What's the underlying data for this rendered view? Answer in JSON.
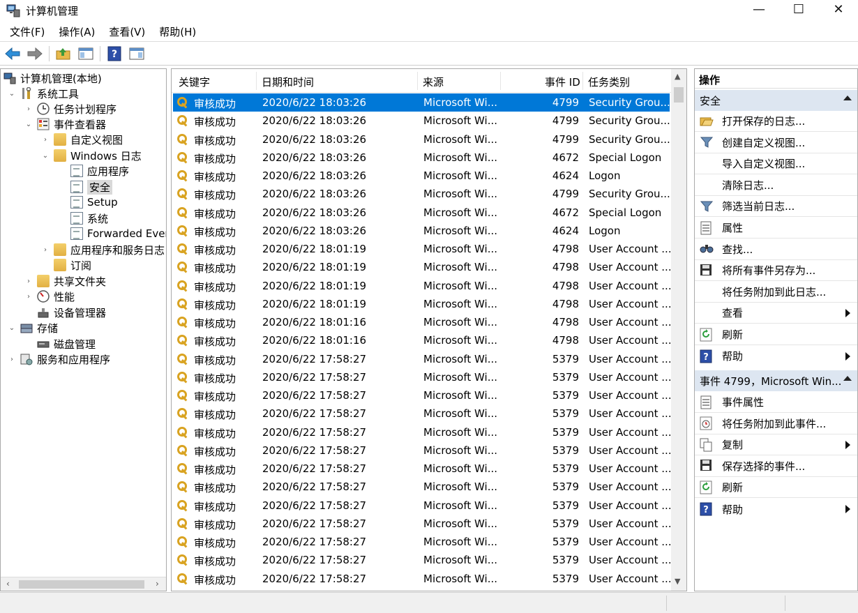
{
  "window": {
    "title": "计算机管理",
    "minimize": "—",
    "maximize": "☐",
    "close": "✕"
  },
  "menu": [
    "文件(F)",
    "操作(A)",
    "查看(V)",
    "帮助(H)"
  ],
  "tree": {
    "items": [
      {
        "label": "计算机管理(本地)",
        "twisty": ""
      },
      {
        "label": "系统工具",
        "twisty": "⌄"
      },
      {
        "label": "任务计划程序",
        "twisty": "›"
      },
      {
        "label": "事件查看器",
        "twisty": "⌄"
      },
      {
        "label": "自定义视图",
        "twisty": "›"
      },
      {
        "label": "Windows 日志",
        "twisty": "⌄"
      },
      {
        "label": "应用程序",
        "twisty": ""
      },
      {
        "label": "安全",
        "twisty": ""
      },
      {
        "label": "Setup",
        "twisty": ""
      },
      {
        "label": "系统",
        "twisty": ""
      },
      {
        "label": "Forwarded Even",
        "twisty": ""
      },
      {
        "label": "应用程序和服务日志",
        "twisty": "›"
      },
      {
        "label": "订阅",
        "twisty": ""
      },
      {
        "label": "共享文件夹",
        "twisty": "›"
      },
      {
        "label": "性能",
        "twisty": "›"
      },
      {
        "label": "设备管理器",
        "twisty": ""
      },
      {
        "label": "存储",
        "twisty": "⌄"
      },
      {
        "label": "磁盘管理",
        "twisty": ""
      },
      {
        "label": "服务和应用程序",
        "twisty": "›"
      }
    ]
  },
  "list": {
    "columns": [
      "关键字",
      "日期和时间",
      "来源",
      "事件 ID",
      "任务类别"
    ],
    "rows": [
      [
        "审核成功",
        "2020/6/22 18:03:26",
        "Microsoft Wi...",
        "4799",
        "Security Grou..."
      ],
      [
        "审核成功",
        "2020/6/22 18:03:26",
        "Microsoft Wi...",
        "4799",
        "Security Grou..."
      ],
      [
        "审核成功",
        "2020/6/22 18:03:26",
        "Microsoft Wi...",
        "4799",
        "Security Grou..."
      ],
      [
        "审核成功",
        "2020/6/22 18:03:26",
        "Microsoft Wi...",
        "4672",
        "Special Logon"
      ],
      [
        "审核成功",
        "2020/6/22 18:03:26",
        "Microsoft Wi...",
        "4624",
        "Logon"
      ],
      [
        "审核成功",
        "2020/6/22 18:03:26",
        "Microsoft Wi...",
        "4799",
        "Security Grou..."
      ],
      [
        "审核成功",
        "2020/6/22 18:03:26",
        "Microsoft Wi...",
        "4672",
        "Special Logon"
      ],
      [
        "审核成功",
        "2020/6/22 18:03:26",
        "Microsoft Wi...",
        "4624",
        "Logon"
      ],
      [
        "审核成功",
        "2020/6/22 18:01:19",
        "Microsoft Wi...",
        "4798",
        "User Account ..."
      ],
      [
        "审核成功",
        "2020/6/22 18:01:19",
        "Microsoft Wi...",
        "4798",
        "User Account ..."
      ],
      [
        "审核成功",
        "2020/6/22 18:01:19",
        "Microsoft Wi...",
        "4798",
        "User Account ..."
      ],
      [
        "审核成功",
        "2020/6/22 18:01:19",
        "Microsoft Wi...",
        "4798",
        "User Account ..."
      ],
      [
        "审核成功",
        "2020/6/22 18:01:16",
        "Microsoft Wi...",
        "4798",
        "User Account ..."
      ],
      [
        "审核成功",
        "2020/6/22 18:01:16",
        "Microsoft Wi...",
        "4798",
        "User Account ..."
      ],
      [
        "审核成功",
        "2020/6/22 17:58:27",
        "Microsoft Wi...",
        "5379",
        "User Account ..."
      ],
      [
        "审核成功",
        "2020/6/22 17:58:27",
        "Microsoft Wi...",
        "5379",
        "User Account ..."
      ],
      [
        "审核成功",
        "2020/6/22 17:58:27",
        "Microsoft Wi...",
        "5379",
        "User Account ..."
      ],
      [
        "审核成功",
        "2020/6/22 17:58:27",
        "Microsoft Wi...",
        "5379",
        "User Account ..."
      ],
      [
        "审核成功",
        "2020/6/22 17:58:27",
        "Microsoft Wi...",
        "5379",
        "User Account ..."
      ],
      [
        "审核成功",
        "2020/6/22 17:58:27",
        "Microsoft Wi...",
        "5379",
        "User Account ..."
      ],
      [
        "审核成功",
        "2020/6/22 17:58:27",
        "Microsoft Wi...",
        "5379",
        "User Account ..."
      ],
      [
        "审核成功",
        "2020/6/22 17:58:27",
        "Microsoft Wi...",
        "5379",
        "User Account ..."
      ],
      [
        "审核成功",
        "2020/6/22 17:58:27",
        "Microsoft Wi...",
        "5379",
        "User Account ..."
      ],
      [
        "审核成功",
        "2020/6/22 17:58:27",
        "Microsoft Wi...",
        "5379",
        "User Account ..."
      ],
      [
        "审核成功",
        "2020/6/22 17:58:27",
        "Microsoft Wi...",
        "5379",
        "User Account ..."
      ],
      [
        "审核成功",
        "2020/6/22 17:58:27",
        "Microsoft Wi...",
        "5379",
        "User Account ..."
      ],
      [
        "审核成功",
        "2020/6/22 17:58:27",
        "Microsoft Wi...",
        "5379",
        "User Account ..."
      ]
    ]
  },
  "actions": {
    "header": "操作",
    "section1": "安全",
    "items1": [
      {
        "label": "打开保存的日志...",
        "icon": "folder-open-icon",
        "submenu": false
      },
      {
        "label": "创建自定义视图...",
        "icon": "filter-icon",
        "submenu": false
      },
      {
        "label": "导入自定义视图...",
        "icon": "",
        "submenu": false
      },
      {
        "label": "清除日志...",
        "icon": "",
        "submenu": false
      },
      {
        "label": "筛选当前日志...",
        "icon": "filter-icon",
        "submenu": false
      },
      {
        "label": "属性",
        "icon": "properties-icon",
        "submenu": false
      },
      {
        "label": "查找...",
        "icon": "binoculars-icon",
        "submenu": false
      },
      {
        "label": "将所有事件另存为...",
        "icon": "save-icon",
        "submenu": false
      },
      {
        "label": "将任务附加到此日志...",
        "icon": "",
        "submenu": false
      },
      {
        "label": "查看",
        "icon": "",
        "submenu": true
      },
      {
        "label": "刷新",
        "icon": "refresh-icon",
        "submenu": false
      },
      {
        "label": "帮助",
        "icon": "help-icon",
        "submenu": true
      }
    ],
    "section2": "事件 4799，Microsoft Win...",
    "items2": [
      {
        "label": "事件属性",
        "icon": "properties-icon",
        "submenu": false
      },
      {
        "label": "将任务附加到此事件...",
        "icon": "task-icon",
        "submenu": false
      },
      {
        "label": "复制",
        "icon": "copy-icon",
        "submenu": true
      },
      {
        "label": "保存选择的事件...",
        "icon": "save-icon",
        "submenu": false
      },
      {
        "label": "刷新",
        "icon": "refresh-icon",
        "submenu": false
      },
      {
        "label": "帮助",
        "icon": "help-icon",
        "submenu": true
      }
    ]
  },
  "colors": {
    "selection": "#0078d7",
    "section_header": "#dde6f1"
  }
}
